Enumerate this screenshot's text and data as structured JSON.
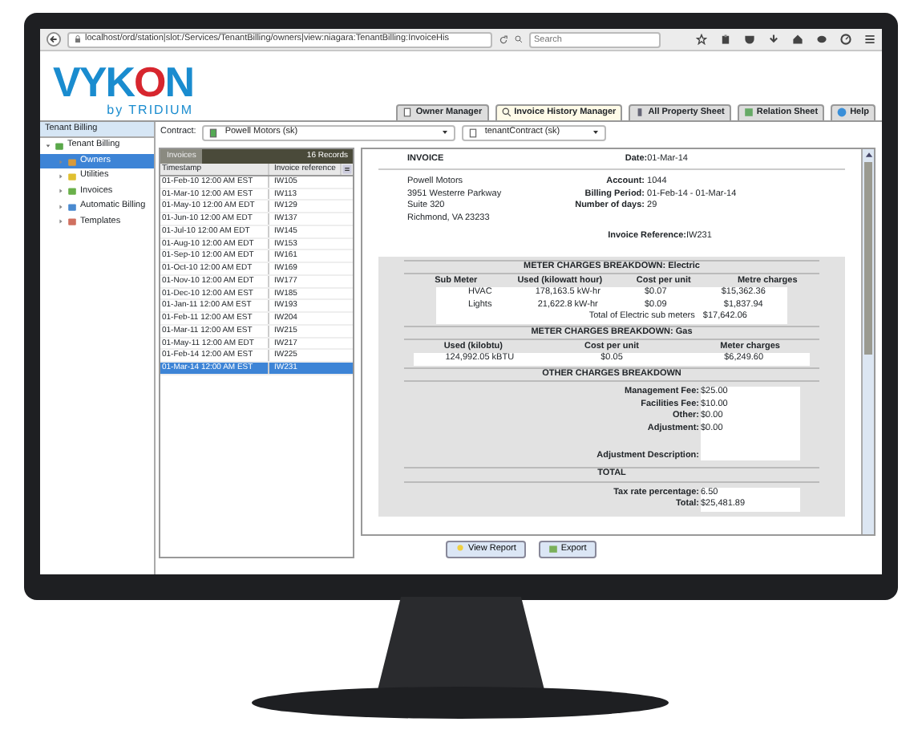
{
  "browser": {
    "url": "localhost/ord/station|slot:/Services/TenantBilling/owners|view:niagara:TenantBilling:InvoiceHis",
    "search_placeholder": "Search"
  },
  "logo": {
    "brand": "VYKON",
    "byline": "by TRIDIUM"
  },
  "tabs": [
    {
      "label": "Owner Manager",
      "selected": false,
      "kind": "owner"
    },
    {
      "label": "Invoice History Manager",
      "selected": true,
      "kind": "search"
    },
    {
      "label": "All Property Sheet",
      "selected": false,
      "kind": "sheet"
    },
    {
      "label": "Relation Sheet",
      "selected": false,
      "kind": "relation"
    },
    {
      "label": "Help",
      "selected": false,
      "kind": "help"
    }
  ],
  "tree": {
    "header": "Tenant Billing",
    "items": [
      {
        "label": "Tenant Billing",
        "expanded": true,
        "selected": false,
        "kind": "billing",
        "children": [
          {
            "label": "Owners",
            "selected": true,
            "kind": "owners"
          },
          {
            "label": "Utilities",
            "selected": false,
            "kind": "utilities"
          },
          {
            "label": "Invoices",
            "selected": false,
            "kind": "invoices"
          },
          {
            "label": "Automatic Billing",
            "selected": false,
            "kind": "auto"
          },
          {
            "label": "Templates",
            "selected": false,
            "kind": "templates"
          }
        ]
      }
    ]
  },
  "contract": {
    "label": "Contract:",
    "owner": "Powell Motors (sk)",
    "contract": "tenantContract (sk)"
  },
  "invoices": {
    "tab": "Invoices",
    "count": "16 Records",
    "columns": [
      "Timestamp",
      "Invoice reference"
    ],
    "rows": [
      {
        "timestamp": "01-Feb-10 12:00 AM EST",
        "reference": "IW105",
        "selected": false
      },
      {
        "timestamp": "01-Mar-10 12:00 AM EST",
        "reference": "IW113",
        "selected": false
      },
      {
        "timestamp": "01-May-10 12:00 AM EDT",
        "reference": "IW129",
        "selected": false
      },
      {
        "timestamp": "01-Jun-10 12:00 AM EDT",
        "reference": "IW137",
        "selected": false
      },
      {
        "timestamp": "01-Jul-10 12:00 AM EDT",
        "reference": "IW145",
        "selected": false
      },
      {
        "timestamp": "01-Aug-10 12:00 AM EDT",
        "reference": "IW153",
        "selected": false
      },
      {
        "timestamp": "01-Sep-10 12:00 AM EDT",
        "reference": "IW161",
        "selected": false
      },
      {
        "timestamp": "01-Oct-10 12:00 AM EDT",
        "reference": "IW169",
        "selected": false
      },
      {
        "timestamp": "01-Nov-10 12:00 AM EDT",
        "reference": "IW177",
        "selected": false
      },
      {
        "timestamp": "01-Dec-10 12:00 AM EST",
        "reference": "IW185",
        "selected": false
      },
      {
        "timestamp": "01-Jan-11 12:00 AM EST",
        "reference": "IW193",
        "selected": false
      },
      {
        "timestamp": "01-Feb-11 12:00 AM EST",
        "reference": "IW204",
        "selected": false
      },
      {
        "timestamp": "01-Mar-11 12:00 AM EST",
        "reference": "IW215",
        "selected": false
      },
      {
        "timestamp": "01-May-11 12:00 AM EDT",
        "reference": "IW217",
        "selected": false
      },
      {
        "timestamp": "01-Feb-14 12:00 AM EST",
        "reference": "IW225",
        "selected": false
      },
      {
        "timestamp": "01-Mar-14 12:00 AM EST",
        "reference": "IW231",
        "selected": true
      }
    ]
  },
  "report": {
    "title": "INVOICE",
    "date": {
      "label": "Date:",
      "value": "01-Mar-14"
    },
    "address": [
      "Powell Motors",
      "3951 Westerre Parkway",
      "Suite 320",
      "Richmond, VA 23233"
    ],
    "account": [
      {
        "label": "Account:",
        "value": "1044"
      },
      {
        "label": "Billing Period:",
        "value": "01-Feb-14 - 01-Mar-14"
      },
      {
        "label": "Number of days:",
        "value": "29"
      }
    ],
    "reference": {
      "label": "Invoice Reference:",
      "value": "IW231"
    },
    "electric": {
      "title": "METER CHARGES BREAKDOWN: Electric",
      "columns": [
        "Sub Meter",
        "Used (kilowatt hour)",
        "Cost per unit",
        "Metre charges"
      ],
      "rows": [
        [
          "HVAC",
          "178,163.5 kW-hr",
          "$0.07",
          "$15,362.36"
        ],
        [
          "Lights",
          "21,622.8 kW-hr",
          "$0.09",
          "$1,837.94"
        ]
      ],
      "total": {
        "label": "Total of Electric sub meters",
        "value": "$17,642.06"
      }
    },
    "gas": {
      "title": "METER CHARGES BREAKDOWN: Gas",
      "columns": [
        "Used (kilobtu)",
        "Cost per unit",
        "Meter charges"
      ],
      "rows": [
        [
          "124,992.05 kBTU",
          "$0.05",
          "$6,249.60"
        ]
      ]
    },
    "other": {
      "title": "OTHER CHARGES BREAKDOWN",
      "fields": [
        {
          "label": "Management Fee:",
          "value": "$25.00"
        },
        {
          "label": "Facilities Fee:",
          "value": "$10.00"
        },
        {
          "label": "Other:",
          "value": "$0.00"
        },
        {
          "label": "Adjustment:",
          "value": "$0.00"
        }
      ],
      "description": "Adjustment Description:"
    },
    "total": {
      "title": "TOTAL",
      "fields": [
        {
          "label": "Tax rate percentage:",
          "value": "6.50"
        },
        {
          "label": "Total:",
          "value": "$25,481.89"
        }
      ]
    }
  },
  "buttons": [
    {
      "label": "View Report",
      "kind": "report"
    },
    {
      "label": "Export",
      "kind": "export"
    }
  ]
}
